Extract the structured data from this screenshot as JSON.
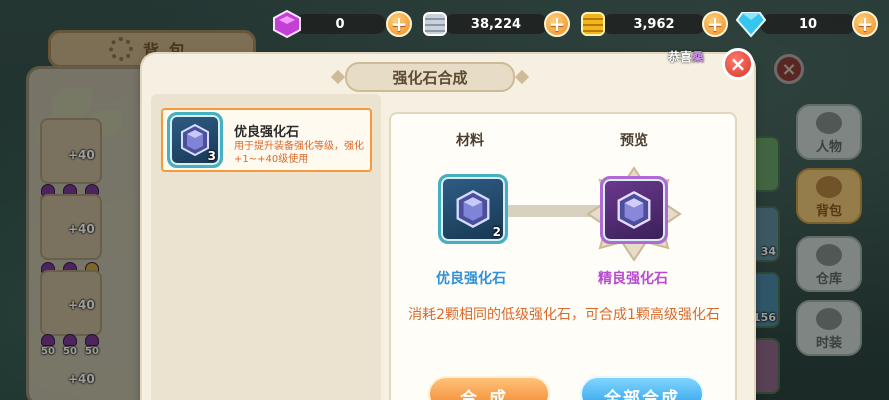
{
  "resources": [
    {
      "name": "purple-crystal",
      "value": "0",
      "color": "#c43fd6"
    },
    {
      "name": "silver",
      "value": "38,224",
      "color": "#c9d2dc"
    },
    {
      "name": "gold",
      "value": "3,962",
      "color": "#f2b61d"
    },
    {
      "name": "diamond",
      "value": "10",
      "color": "#35c6f0"
    }
  ],
  "plus_symbol": "+",
  "background": {
    "bag_title": "背包",
    "bag_plus_labels": [
      "+40",
      "+40",
      "+40",
      "+40"
    ],
    "bag_chip_value": "50",
    "side_buttons": [
      "人物",
      "背包",
      "仓库",
      "时装"
    ],
    "side_strip_numbers": [
      "34",
      "156"
    ],
    "congrats_prefix": "恭喜",
    "congrats_name": "桑"
  },
  "dialog": {
    "title": "强化石合成",
    "close_symbol": "×"
  },
  "list": {
    "items": [
      {
        "name": "优良强化石",
        "count": "3",
        "description": "用于提升装备强化等级，强化+1~+40级使用"
      }
    ]
  },
  "synthesis": {
    "material_label": "材料",
    "preview_label": "预览",
    "material": {
      "name": "优良强化石",
      "count": "2",
      "name_color": "#2f8fd8"
    },
    "result": {
      "name": "精良强化石",
      "name_color": "#b94ad2"
    },
    "description": "消耗2颗相同的低级强化石，可合成1颗高级强化石",
    "compose_button": "合成",
    "compose_all_button": "全部合成"
  }
}
